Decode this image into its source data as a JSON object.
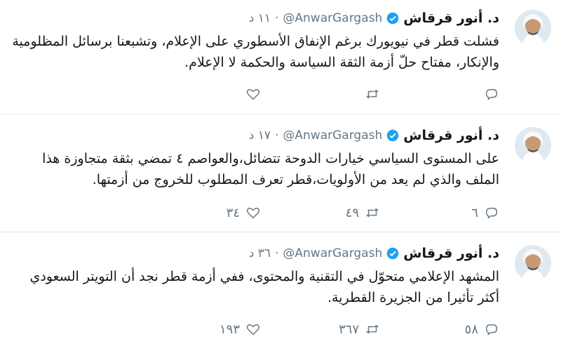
{
  "tweets": [
    {
      "name": "د. أنور قرقاش",
      "handle": "@AnwarGargash",
      "time": "١١ د",
      "text": "فشلت قطر في نيويورك برغم الإنفاق الأسطوري على الإعلام، وتشبعنا برسائل المظلومية والإنكار، مفتاح حلّ أزمة الثقة السياسة والحكمة لا الإعلام.",
      "replies": "",
      "retweets": "",
      "likes": ""
    },
    {
      "name": "د. أنور قرقاش",
      "handle": "@AnwarGargash",
      "time": "١٧ د",
      "text": "على المستوى السياسي خيارات الدوحة تتضائل،والعواصم ٤ تمضي بثقة متجاوزة هذا الملف والذي لم يعد من الأولويات،قطر تعرف المطلوب للخروج من أزمتها.",
      "replies": "٦",
      "retweets": "٤٩",
      "likes": "٣٤"
    },
    {
      "name": "د. أنور قرقاش",
      "handle": "@AnwarGargash",
      "time": "٣٦ د",
      "text": "المشهد الإعلامي متحوّل في التقنية والمحتوى، ففي أزمة قطر نجد أن التويتر السعودي أكثر تأثيرا من الجزيرة القطرية.",
      "replies": "٥٨",
      "retweets": "٣٦٧",
      "likes": "١٩٣"
    }
  ],
  "separator": "·",
  "icons": {
    "reply": "reply-icon",
    "retweet": "retweet-icon",
    "like": "heart-icon",
    "verified": "verified-badge-icon"
  },
  "colors": {
    "verified": "#1da1f2",
    "secondary_text": "#657786",
    "border": "#e1e8ed"
  }
}
